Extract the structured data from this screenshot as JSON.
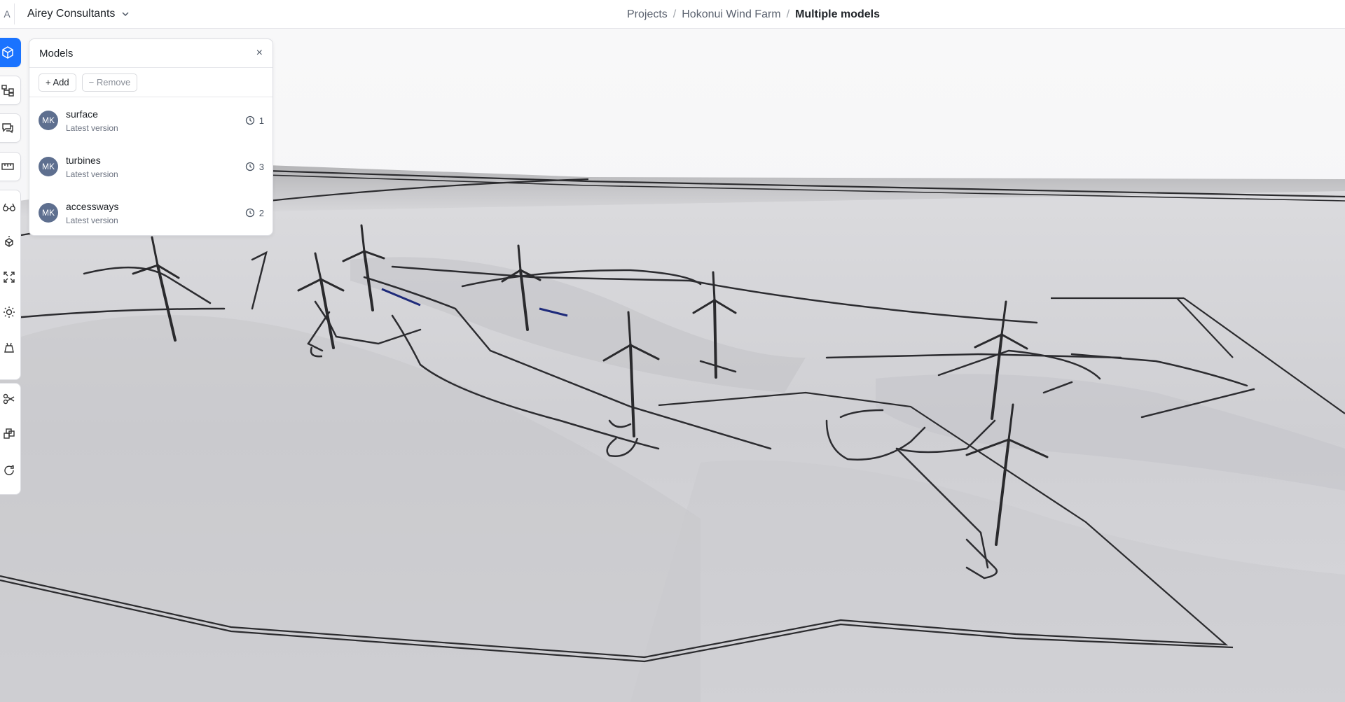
{
  "topbar": {
    "workspace_initial": "A",
    "workspace_name": "Airey Consultants",
    "breadcrumb": [
      "Projects",
      "Hokonui Wind Farm",
      "Multiple models"
    ]
  },
  "panel": {
    "title": "Models",
    "close": "×",
    "add_label": "+ Add",
    "remove_label": "− Remove",
    "models": [
      {
        "initials": "MK",
        "name": "surface",
        "version_label": "Latest version",
        "versions": "1"
      },
      {
        "initials": "MK",
        "name": "turbines",
        "version_label": "Latest version",
        "versions": "3"
      },
      {
        "initials": "MK",
        "name": "accessways",
        "version_label": "Latest version",
        "versions": "2"
      }
    ]
  },
  "toolbar": {
    "items": [
      "models-icon",
      "scene-tree-icon",
      "discussions-icon",
      "measure-icon",
      "views-icon",
      "explode-icon",
      "zoom-extents-icon",
      "light-icon",
      "section-icon",
      "filter-icon",
      "objects-icon",
      "reset-icon"
    ]
  },
  "colors": {
    "accent": "#1a73ff",
    "avatar": "#5e6f8f",
    "terrain": "#d6d6da",
    "line": "#2b2b2e"
  }
}
